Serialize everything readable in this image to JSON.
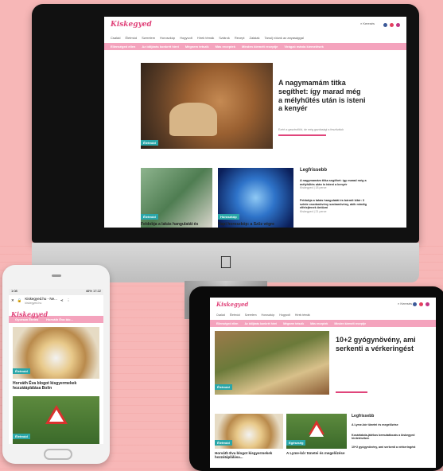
{
  "brand": {
    "logo": "Kiskegyed",
    "accent": "#e0457b",
    "pink": "#f4a3bd",
    "tag_color": "#2aa6a8"
  },
  "desktop": {
    "search_label": "Keresés",
    "nav": [
      "Család",
      "Életmód",
      "Szerelem",
      "Horoszkóp",
      "Hogyvolt",
      "Hírek témák",
      "Sztárok",
      "Recept",
      "Zalaiak",
      "Tanulj rólunk az anyasággal"
    ],
    "pinkbar": [
      "Ellenséged ellen",
      "Az időjárás konkrét hírei",
      "Mégnem tetszik",
      "Más receptek",
      "Minden kiemelt receptje",
      "Virágzó mánia kiemelések"
    ],
    "hero": {
      "title": "A nagymamám titka segíthet: így marad még a mélyhűtés után is isteni a kenyér",
      "tag": "Életmód",
      "excerpt": "Ezért a gasztroföld, de még gazdasági a fesztiválok"
    },
    "cards": [
      {
        "title": "Feldobja a lakás hangulatát és",
        "tag": "Életmód"
      },
      {
        "title": "Napi horoszkóp: a Szűz végre",
        "tag": "Horoszkóp"
      }
    ],
    "latest": {
      "heading": "Legfrissebb",
      "items": [
        {
          "title": "A nagymamám titka segíthet: így marad még a mélyhűtés után is isteni a kenyér",
          "meta": "Kiskegyed | 18 perce"
        },
        {
          "title": "Feldobja a lakás hangulatát és bármit kibír: 3 szinte csodanövény szobanövény, akik mindig elfelejtenek öntözni",
          "meta": "Kiskegyed | 21 perce"
        }
      ]
    }
  },
  "phone": {
    "status_left": "1:08",
    "status_right": "46% 17:22",
    "url": "Kiskegyed.hu - Ne...",
    "url_sub": "kiskegyed.hu",
    "pinkbar": [
      "Gyorsan Ételek",
      "Horváth Éva blo..."
    ],
    "card1": {
      "tag": "Életmód",
      "title": "Horváth Éva blogot kisgyermekek hozzátáplálása Bolin"
    },
    "card2": {
      "tag": "Életmód"
    }
  },
  "tablet": {
    "search_label": "Keresés",
    "hero": {
      "title": "10+2 gyógynövény, ami serkenti a vérkeringést",
      "tag": "Életmód"
    },
    "latest": {
      "heading": "Legfrissebb",
      "items": [
        {
          "title": "A Lyme-kór tünetei és megelőzése"
        },
        {
          "title": "Kosárlabda-játékos bemutatkozás a kiskegyed hirdetésében"
        },
        {
          "title": "10+2 gyógynövény, ami serkenti a vérkeringést"
        }
      ]
    },
    "cards": [
      {
        "title": "Horváth Éva blogot kisgyermekek hozzátáplálása...",
        "tag": "Életmód"
      },
      {
        "title": "A Lyme-kór tünetei és megelőzése",
        "tag": "Egészség"
      }
    ]
  }
}
